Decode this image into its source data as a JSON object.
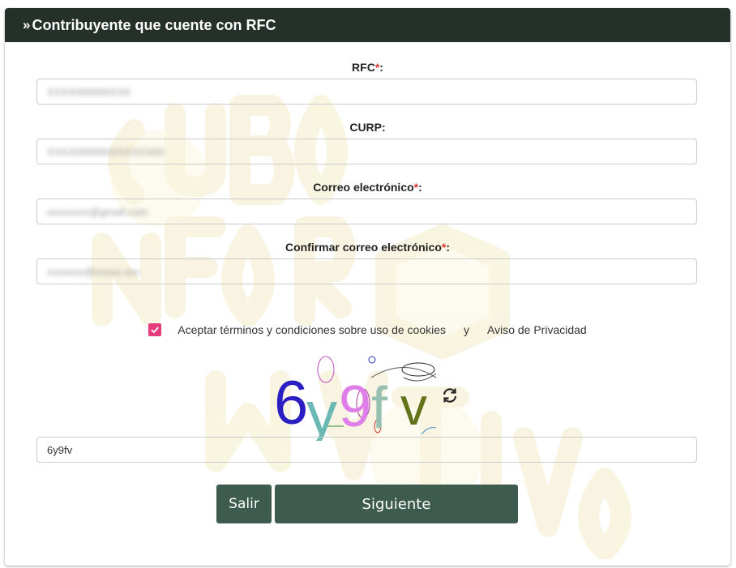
{
  "header": {
    "chevron": "»",
    "title": "Contribuyente que cuente con RFC"
  },
  "form": {
    "rfc": {
      "label": "RFC",
      "required_mark": "*",
      "suffix": ":",
      "value": "XXXX000000XX0"
    },
    "curp": {
      "label": "CURP:",
      "value": "XXXX000000XXXXXX00"
    },
    "email": {
      "label": "Correo electrónico",
      "required_mark": "*",
      "suffix": ":",
      "value": "xxxxxxxx@gmail.com"
    },
    "email_confirm": {
      "label": "Confirmar correo electrónico",
      "required_mark": "*",
      "suffix": ":",
      "value": "xxxxxxx@xxxxx.xxx"
    },
    "terms": {
      "checked": true,
      "link1": "Aceptar términos y condiciones sobre uso de cookies",
      "conjunction": "y",
      "link2": "Aviso de Privacidad"
    },
    "captcha": {
      "chars": [
        "6",
        "y",
        "9",
        "f",
        "v"
      ],
      "refresh_icon": "refresh-icon",
      "input_value": "6y9fv"
    }
  },
  "buttons": {
    "exit": "Salir",
    "next": "Siguiente"
  },
  "colors": {
    "header_bg": "#243028",
    "button_bg": "#3e5c4d",
    "checkbox": "#e53d7b",
    "required": "#dd3333"
  }
}
